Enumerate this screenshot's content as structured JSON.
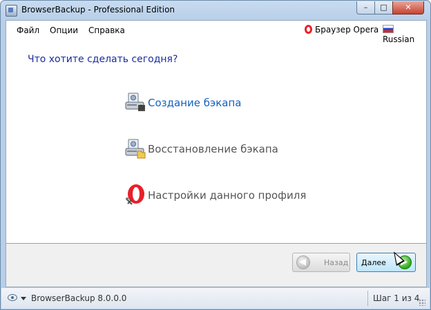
{
  "window": {
    "title": "BrowserBackup - Professional Edition",
    "controls": {
      "minimize": "–",
      "maximize": "□",
      "close": "✕"
    }
  },
  "menu": {
    "items": [
      "Файл",
      "Опции",
      "Справка"
    ],
    "browser_label": "Браузер Opera",
    "language": "Russian"
  },
  "main": {
    "question": "Что хотите сделать сегодня?",
    "actions": [
      {
        "label": "Создание бэкапа",
        "icon": "backup-drive-icon",
        "color": "#1560bd"
      },
      {
        "label": "Восстановление бэкапа",
        "icon": "restore-drive-icon",
        "color": "#555555"
      },
      {
        "label": "Настройки данного профиля",
        "icon": "opera-settings-icon",
        "color": "#555555"
      }
    ]
  },
  "buttons": {
    "back": "Назад",
    "next": "Далее"
  },
  "status": {
    "version": "BrowserBackup 8.0.0.0",
    "step": "Шаг 1 из 4"
  },
  "colors": {
    "accent_link": "#1560bd",
    "question": "#1b2d9c",
    "opera_red": "#e8202a"
  }
}
